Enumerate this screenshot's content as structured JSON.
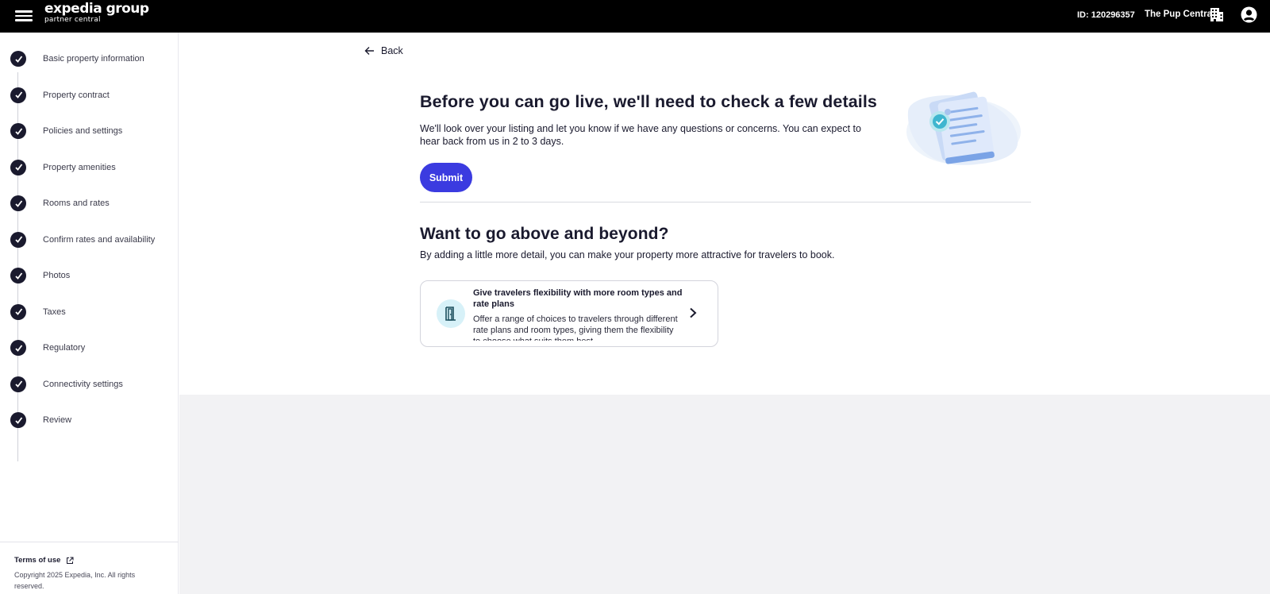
{
  "topbar": {
    "logo_main": "expedia group",
    "logo_sub": "partner central",
    "account_id": "ID: 120296357",
    "property_name": "The Pup Central"
  },
  "sidebar": {
    "steps": [
      {
        "label": "Basic property information",
        "completed": true
      },
      {
        "label": "Property contract",
        "completed": true
      },
      {
        "label": "Policies and settings",
        "completed": true
      },
      {
        "label": "Property amenities",
        "completed": true
      },
      {
        "label": "Rooms and rates",
        "completed": true
      },
      {
        "label": "Confirm rates and availability",
        "completed": true
      },
      {
        "label": "Photos",
        "completed": true
      },
      {
        "label": "Taxes",
        "completed": true
      },
      {
        "label": "Regulatory",
        "completed": true
      },
      {
        "label": "Connectivity settings",
        "completed": true
      },
      {
        "label": "Review",
        "completed": true
      }
    ],
    "footer": {
      "terms_label": "Terms of use",
      "copyright": "Copyright 2025 Expedia, Inc. All rights reserved."
    }
  },
  "main": {
    "back_label": "Back",
    "review": {
      "heading": "Before you can go live, we'll need to check a few details",
      "description": "We'll look over your listing and let you know if we have any questions or concerns. You can expect to hear back from us in 2 to 3 days.",
      "submit_label": "Submit"
    },
    "extras": {
      "heading": "Want to go above and beyond?",
      "description": "By adding a little more detail, you can make your property more attractive for travelers to book.",
      "card": {
        "title": "Give travelers flexibility with more room types and rate plans",
        "body": "Offer a range of choices to travelers through different rate plans and room types, giving them the flexibility to choose what suits them best.",
        "icon": "door-icon"
      }
    }
  },
  "colors": {
    "topbar_bg": "#000000",
    "accent": "#3b3be0",
    "step_check_bg": "#1a1a2e",
    "card_icon_bg": "#d7f1f8",
    "grey_area": "#f2f2f4"
  }
}
